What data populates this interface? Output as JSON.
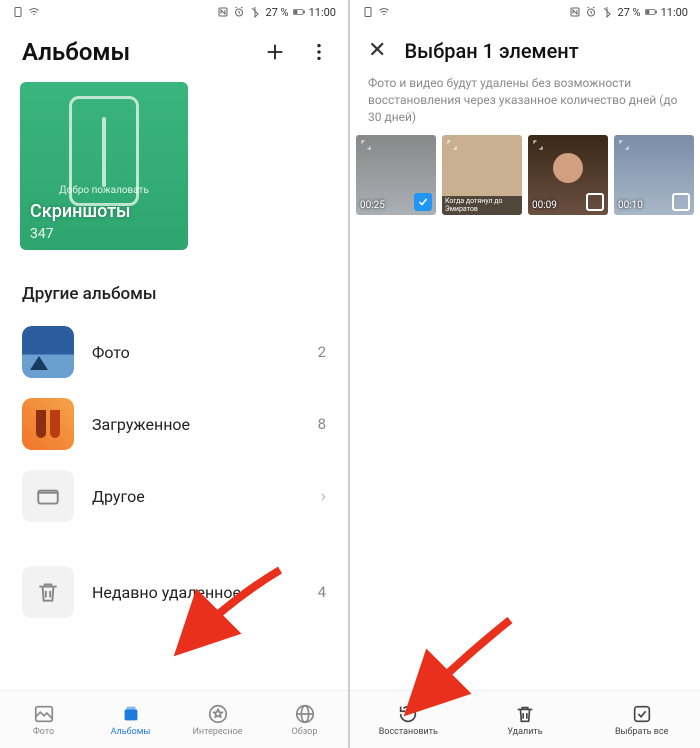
{
  "status": {
    "battery": "27 %",
    "time": "11:00"
  },
  "left": {
    "title": "Альбомы",
    "card": {
      "welcome": "Добро пожаловать",
      "title": "Скриншоты",
      "count": "347"
    },
    "other_title": "Другие альбомы",
    "albums": [
      {
        "name": "Фото",
        "count": "2"
      },
      {
        "name": "Загруженное",
        "count": "8"
      },
      {
        "name": "Другое",
        "count": ""
      },
      {
        "name": "Недавно удаленное",
        "count": "4"
      }
    ],
    "nav": {
      "photo": "Фото",
      "albums": "Альбомы",
      "interesting": "Интересное",
      "browse": "Обзор"
    }
  },
  "right": {
    "title": "Выбран 1 элемент",
    "notice": "Фото и видео будут удалены без возможности восстановления через указанное количество дней (до 30 дней)",
    "videos": [
      {
        "time": "00:25",
        "checked": true
      },
      {
        "time": "",
        "checked": false,
        "caption": "Когда дотянул до Эмиратов"
      },
      {
        "time": "00:09",
        "checked": false
      },
      {
        "time": "00:10",
        "checked": false
      }
    ],
    "actions": {
      "restore": "Восстановить",
      "delete": "Удалить",
      "select_all": "Выбрать все"
    }
  }
}
